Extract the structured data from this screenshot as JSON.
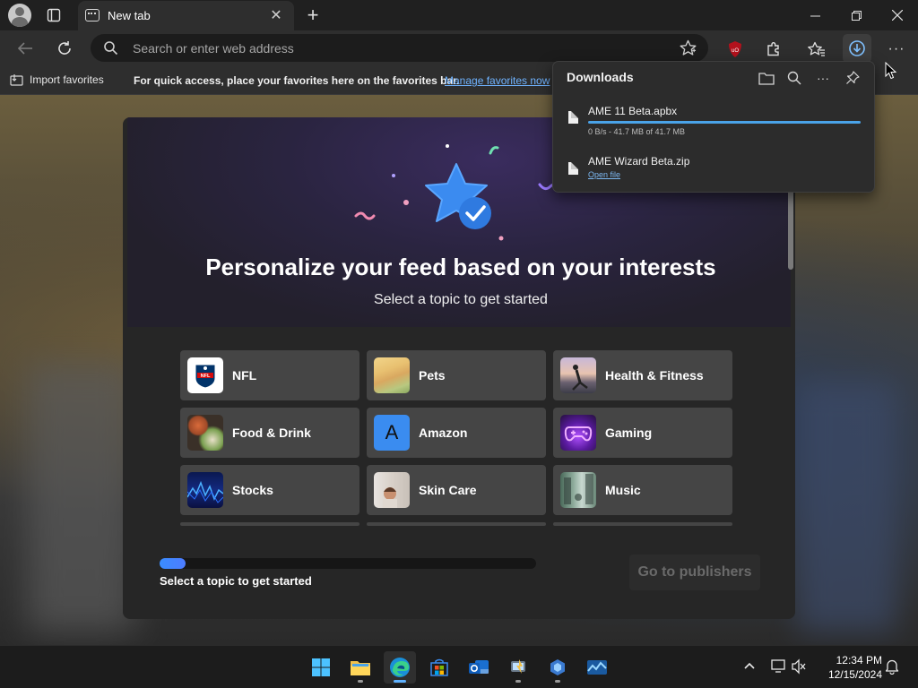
{
  "browser": {
    "tab_title": "New tab",
    "address_placeholder": "Search or enter web address",
    "favorites_bar": {
      "import_label": "Import favorites",
      "hint": "For quick access, place your favorites here on the favorites bar.",
      "manage_link": "Manage favorites now"
    }
  },
  "downloads": {
    "title": "Downloads",
    "items": [
      {
        "name": "AME 11 Beta.apbx",
        "status": "0 B/s - 41.7 MB of 41.7 MB",
        "progress": 1.0
      },
      {
        "name": "AME Wizard Beta.zip",
        "action": "Open file"
      }
    ]
  },
  "feed": {
    "title": "Personalize your feed based on your interests",
    "subtitle": "Select a topic to get started",
    "topics": [
      {
        "label": "NFL",
        "icon": "nfl-logo-icon"
      },
      {
        "label": "Pets",
        "icon": "pets-thumbnail"
      },
      {
        "label": "Health & Fitness",
        "icon": "health-fitness-thumbnail"
      },
      {
        "label": "Food & Drink",
        "icon": "food-drink-thumbnail"
      },
      {
        "label": "Amazon",
        "icon": "amazon-letter-icon"
      },
      {
        "label": "Gaming",
        "icon": "gaming-controller-thumbnail"
      },
      {
        "label": "Stocks",
        "icon": "stocks-chart-thumbnail"
      },
      {
        "label": "Skin Care",
        "icon": "skin-care-thumbnail"
      },
      {
        "label": "Music",
        "icon": "music-thumbnail"
      }
    ],
    "amazon_letter": "A",
    "progress": 0.07,
    "progress_label": "Select a topic to get started",
    "next_button": "Go to publishers"
  },
  "taskbar": {
    "apps": [
      "start-icon",
      "file-explorer-icon",
      "edge-icon",
      "store-icon",
      "outlook-icon",
      "app-icon",
      "app-icon-2",
      "app-icon-3"
    ],
    "time": "12:34 PM",
    "date": "12/15/2024"
  },
  "colors": {
    "accent": "#4aa3e8",
    "link": "#6fb3ff",
    "card": "#262626",
    "topic_tile": "#454545"
  }
}
